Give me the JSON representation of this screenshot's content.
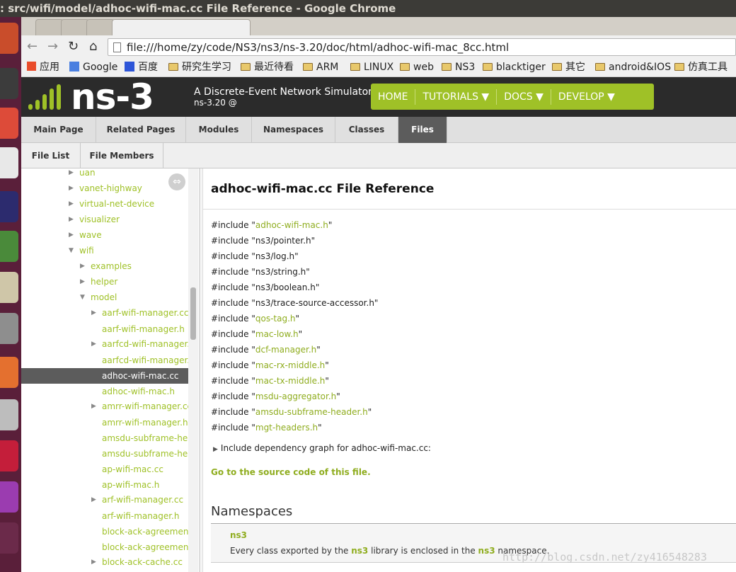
{
  "window": {
    "title": ": src/wifi/model/adhoc-wifi-mac.cc File Reference - Google Chrome"
  },
  "browser": {
    "url": "file:///home/zy/code/NS3/ns3/ns-3.20/doc/html/adhoc-wifi-mac_8cc.html",
    "bookmarks": [
      "应用",
      "Google",
      "百度",
      "研究生学习",
      "最近待看",
      "ARM",
      "LINUX",
      "web",
      "NS3",
      "blacktiger",
      "其它",
      "android&IOS",
      "仿真工具"
    ]
  },
  "site": {
    "logo_text": "ns-3",
    "tagline": "A Discrete-Event Network Simulator",
    "version": "ns-3.20 @",
    "menu": [
      "HOME",
      "TUTORIALS ▼",
      "DOCS ▼",
      "DEVELOP ▼"
    ],
    "main_tabs": [
      "Main Page",
      "Related Pages",
      "Modules",
      "Namespaces",
      "Classes",
      "Files"
    ],
    "sub_tabs": [
      "File List",
      "File Members"
    ]
  },
  "navtree": [
    {
      "label": "uan",
      "arrow": "▶"
    },
    {
      "label": "vanet-highway",
      "arrow": "▶"
    },
    {
      "label": "virtual-net-device",
      "arrow": "▶"
    },
    {
      "label": "visualizer",
      "arrow": "▶"
    },
    {
      "label": "wave",
      "arrow": "▶"
    },
    {
      "label": "wifi",
      "arrow": "▼"
    },
    {
      "label": "examples",
      "arrow": "▶"
    },
    {
      "label": "helper",
      "arrow": "▶"
    },
    {
      "label": "model",
      "arrow": "▼"
    },
    {
      "label": "aarf-wifi-manager.cc",
      "arrow": "▶"
    },
    {
      "label": "aarf-wifi-manager.h",
      "arrow": ""
    },
    {
      "label": "aarfcd-wifi-manager.cc",
      "arrow": "▶"
    },
    {
      "label": "aarfcd-wifi-manager.h",
      "arrow": ""
    },
    {
      "label": "adhoc-wifi-mac.cc",
      "arrow": ""
    },
    {
      "label": "adhoc-wifi-mac.h",
      "arrow": ""
    },
    {
      "label": "amrr-wifi-manager.cc",
      "arrow": "▶"
    },
    {
      "label": "amrr-wifi-manager.h",
      "arrow": ""
    },
    {
      "label": "amsdu-subframe-header.cc",
      "arrow": ""
    },
    {
      "label": "amsdu-subframe-header.h",
      "arrow": ""
    },
    {
      "label": "ap-wifi-mac.cc",
      "arrow": ""
    },
    {
      "label": "ap-wifi-mac.h",
      "arrow": ""
    },
    {
      "label": "arf-wifi-manager.cc",
      "arrow": "▶"
    },
    {
      "label": "arf-wifi-manager.h",
      "arrow": ""
    },
    {
      "label": "block-ack-agreement.cc",
      "arrow": ""
    },
    {
      "label": "block-ack-agreement.h",
      "arrow": ""
    },
    {
      "label": "block-ack-cache.cc",
      "arrow": "▶"
    }
  ],
  "page": {
    "title": "adhoc-wifi-mac.cc File Reference",
    "include_keyword": "#include",
    "includes": [
      {
        "file": "adhoc-wifi-mac.h",
        "link": true
      },
      {
        "file": "ns3/pointer.h",
        "link": false
      },
      {
        "file": "ns3/log.h",
        "link": false
      },
      {
        "file": "ns3/string.h",
        "link": false
      },
      {
        "file": "ns3/boolean.h",
        "link": false
      },
      {
        "file": "ns3/trace-source-accessor.h",
        "link": false
      },
      {
        "file": "qos-tag.h",
        "link": true
      },
      {
        "file": "mac-low.h",
        "link": true
      },
      {
        "file": "dcf-manager.h",
        "link": true
      },
      {
        "file": "mac-rx-middle.h",
        "link": true
      },
      {
        "file": "mac-tx-middle.h",
        "link": true
      },
      {
        "file": "msdu-aggregator.h",
        "link": true
      },
      {
        "file": "amsdu-subframe-header.h",
        "link": true
      },
      {
        "file": "mgt-headers.h",
        "link": true
      }
    ],
    "dep_graph": "Include dependency graph for adhoc-wifi-mac.cc:",
    "go_source": "Go to the source code of this file.",
    "namespaces_heading": "Namespaces",
    "namespace": {
      "name": "ns3",
      "desc_before": "Every class exported by the ",
      "desc_link1": "ns3",
      "desc_middle": " library is enclosed in the ",
      "desc_link2": "ns3",
      "desc_after": " namespace."
    }
  },
  "watermark": "http://blog.csdn.net/zy416548283",
  "colors": {
    "accent": "#9fc127",
    "link": "#8fad1f",
    "header_bg": "#2b2b2b",
    "selected_tab": "#5c5c5c"
  }
}
